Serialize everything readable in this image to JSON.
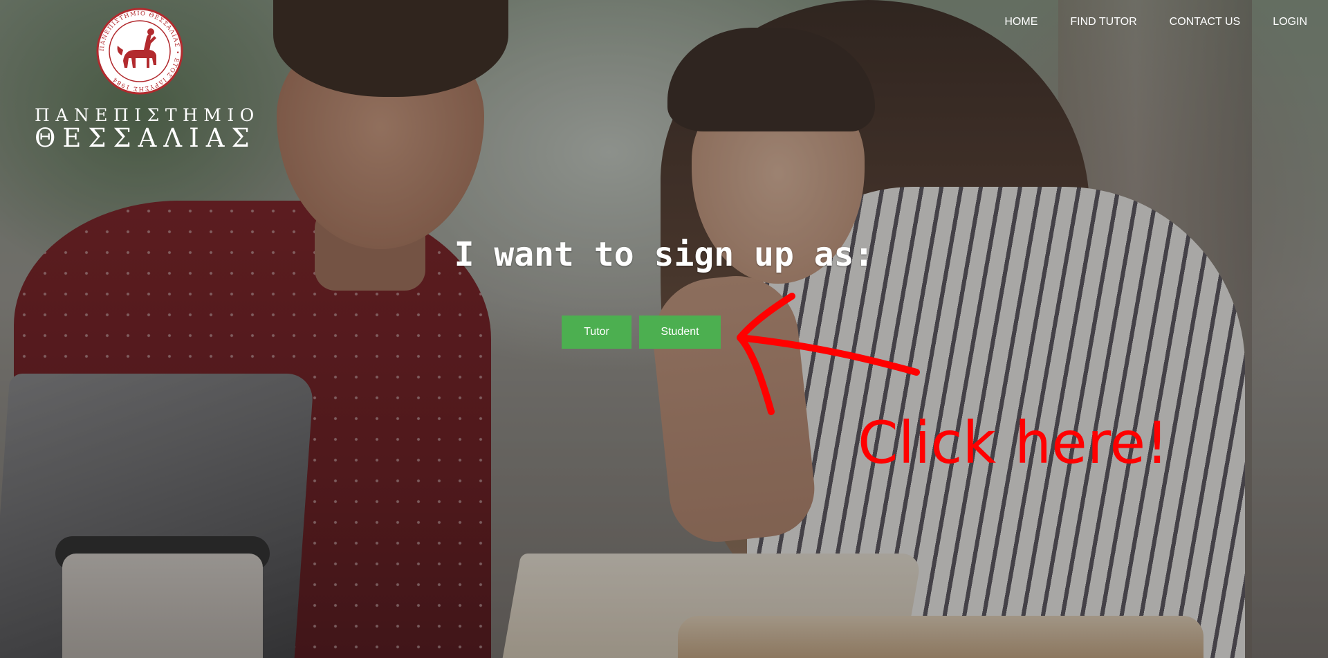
{
  "logo": {
    "seal_text": "ΠΑΝΕΠΙΣΤΗΜΙΟ ΘΕΣΣΑΛΙΑΣ • ΕΤΟΣ ΙΔΡΥΣΗΣ 1984",
    "line1": "ΠΑΝΕΠΙΣΤΗΜΙΟ",
    "line2": "ΘΕΣΣΑΛΙΑΣ"
  },
  "nav": {
    "items": [
      {
        "label": "HOME"
      },
      {
        "label": "FIND TUTOR"
      },
      {
        "label": "CONTACT US"
      },
      {
        "label": "LOGIN"
      }
    ]
  },
  "signup": {
    "heading": "I want to sign up as:",
    "tutor_label": "Tutor",
    "student_label": "Student"
  },
  "annotation": {
    "text": "Click here!",
    "color": "#ff0000"
  },
  "colors": {
    "button_green": "#4caf50",
    "seal_red": "#b22a2e"
  }
}
